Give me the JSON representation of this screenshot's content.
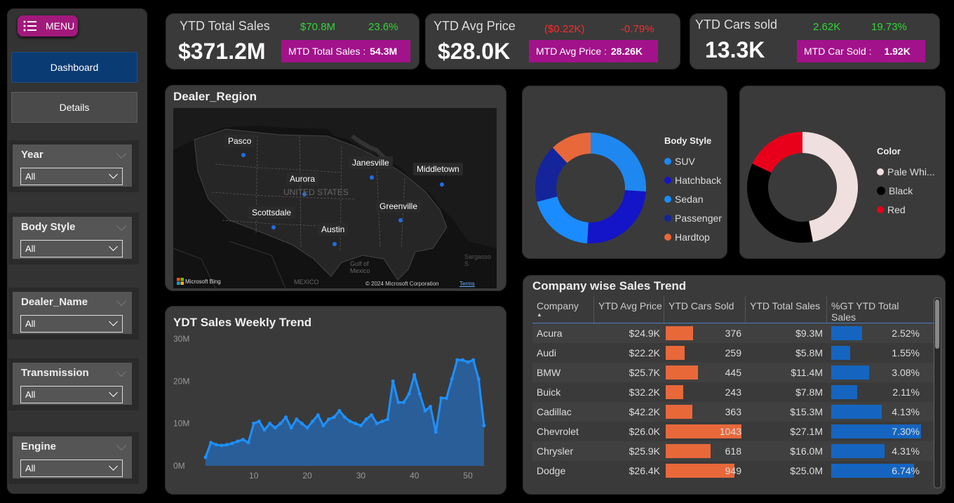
{
  "menu": {
    "label": "MENU"
  },
  "nav": {
    "dashboard": "Dashboard",
    "details": "Details"
  },
  "slicers": [
    {
      "title": "Year",
      "value": "All"
    },
    {
      "title": "Body Style",
      "value": "All"
    },
    {
      "title": "Dealer_Name",
      "value": "All"
    },
    {
      "title": "Transmission",
      "value": "All"
    },
    {
      "title": "Engine",
      "value": "All"
    }
  ],
  "kpis": {
    "sales": {
      "label": "YTD Total Sales",
      "value": "$371.2M",
      "change": "$70.8M",
      "pct": "23.6%",
      "mtd_label": "MTD Total Sales :",
      "mtd_value": "54.3M"
    },
    "price": {
      "label": "YTD Avg Price",
      "value": "$28.0K",
      "change": "($0.22K)",
      "pct": "-0.79%",
      "mtd_label": "MTD Avg Price :",
      "mtd_value": "28.26K"
    },
    "cars": {
      "label": "YTD Cars sold",
      "value": "13.3K",
      "change": "2.62K",
      "pct": "19.73%",
      "mtd_label": "MTD Car Sold :",
      "mtd_value": "1.92K"
    }
  },
  "map": {
    "title": "Dealer_Region",
    "cities": [
      "Pasco",
      "Aurora",
      "Janesville",
      "Middletown",
      "Scottsdale",
      "Greenville",
      "Austin"
    ],
    "country_label": "UNITED STATES",
    "gulf_label": "Gulf of Mexico",
    "mexico_label": "MEXICO",
    "sargasso_label": "Sargasso S",
    "bing_label": "Microsoft Bing",
    "copyright": "© 2024 Microsoft Corporation",
    "terms": "Terms"
  },
  "body_style": {
    "title": "Body Style",
    "items": [
      {
        "name": "SUV",
        "value": 26,
        "color": "#1e88f0"
      },
      {
        "name": "Hatchback",
        "value": 25,
        "color": "#1414c8"
      },
      {
        "name": "Sedan",
        "value": 20,
        "color": "#1a8cff"
      },
      {
        "name": "Passenger",
        "value": 17,
        "color": "#14259c"
      },
      {
        "name": "Hardtop",
        "value": 12,
        "color": "#e8683a"
      }
    ]
  },
  "color": {
    "title": "Color",
    "items": [
      {
        "name": "Pale Whi...",
        "value": 47,
        "color": "#efdfdf"
      },
      {
        "name": "Black",
        "value": 35,
        "color": "#000000"
      },
      {
        "name": "Red",
        "value": 18,
        "color": "#e8001a"
      }
    ]
  },
  "trend": {
    "title": "YDT Sales Weekly Trend"
  },
  "chart_data": {
    "type": "area",
    "yticks": [
      "30M",
      "20M",
      "10M",
      "0M"
    ],
    "xticks": [
      "10",
      "20",
      "30",
      "40",
      "50"
    ],
    "ylim": [
      0,
      30
    ],
    "x": [
      1,
      2,
      3,
      4,
      5,
      6,
      7,
      8,
      9,
      10,
      11,
      12,
      13,
      14,
      15,
      16,
      17,
      18,
      19,
      20,
      21,
      22,
      23,
      24,
      25,
      26,
      27,
      28,
      29,
      30,
      31,
      32,
      33,
      34,
      35,
      36,
      37,
      38,
      39,
      40,
      41,
      42,
      43,
      44,
      45,
      46,
      47,
      48,
      49,
      50,
      51,
      52,
      53
    ],
    "values": [
      2,
      5.5,
      5,
      4.8,
      5,
      5.3,
      5.8,
      6.2,
      5.5,
      10,
      10.5,
      8.5,
      10,
      9,
      10,
      11.5,
      9,
      11,
      10,
      9,
      10.5,
      12,
      9.5,
      11,
      11.5,
      13,
      11.5,
      10.5,
      10,
      9.5,
      11,
      12,
      10,
      10.5,
      11,
      20,
      15,
      15,
      17,
      21.5,
      17,
      13,
      14,
      8,
      16,
      16,
      20.5,
      25,
      25,
      24.5,
      25,
      20.5,
      9.5
    ]
  },
  "table": {
    "title": "Company wise Sales Trend",
    "columns": [
      "Company",
      "YTD Avg Price",
      "YTD Cars Sold",
      "YTD Total Sales",
      "%GT YTD Total Sales"
    ],
    "max_cars": 1043,
    "max_pct": 7.3,
    "rows": [
      {
        "company": "Acura",
        "avg": "$24.9K",
        "cars": 376,
        "sales": "$9.3M",
        "pct": 2.52,
        "pct_label": "2.52%"
      },
      {
        "company": "Audi",
        "avg": "$22.2K",
        "cars": 259,
        "sales": "$5.8M",
        "pct": 1.55,
        "pct_label": "1.55%"
      },
      {
        "company": "BMW",
        "avg": "$25.7K",
        "cars": 445,
        "sales": "$11.4M",
        "pct": 3.08,
        "pct_label": "3.08%"
      },
      {
        "company": "Buick",
        "avg": "$32.2K",
        "cars": 243,
        "sales": "$7.8M",
        "pct": 2.11,
        "pct_label": "2.11%"
      },
      {
        "company": "Cadillac",
        "avg": "$42.2K",
        "cars": 363,
        "sales": "$15.3M",
        "pct": 4.13,
        "pct_label": "4.13%"
      },
      {
        "company": "Chevrolet",
        "avg": "$26.0K",
        "cars": 1043,
        "sales": "$27.1M",
        "pct": 7.3,
        "pct_label": "7.30%"
      },
      {
        "company": "Chrysler",
        "avg": "$25.9K",
        "cars": 618,
        "sales": "$16.0M",
        "pct": 4.31,
        "pct_label": "4.31%"
      },
      {
        "company": "Dodge",
        "avg": "$26.4K",
        "cars": 949,
        "sales": "$25.0M",
        "pct": 6.74,
        "pct_label": "6.74%"
      }
    ]
  }
}
